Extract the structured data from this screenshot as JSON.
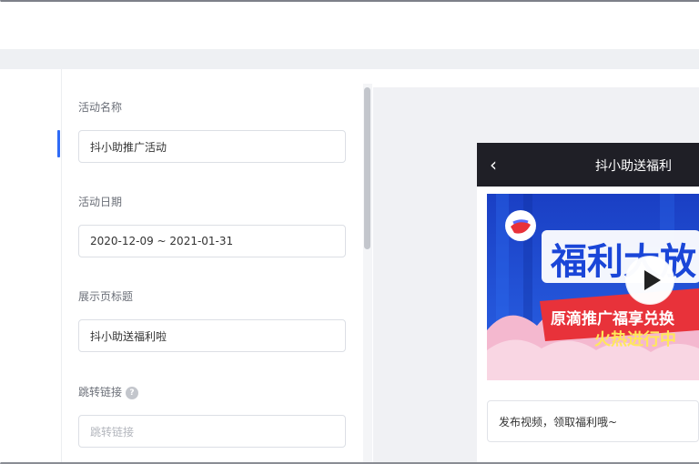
{
  "form": {
    "activity_name": {
      "label": "活动名称",
      "value": "抖小助推广活动"
    },
    "activity_date": {
      "label": "活动日期",
      "value": "2020-12-09 ~ 2021-01-31"
    },
    "page_title": {
      "label": "展示页标题",
      "value": "抖小助送福利啦"
    },
    "jump_link": {
      "label": "跳转链接",
      "placeholder": "跳转链接",
      "help_icon": "?"
    }
  },
  "preview": {
    "back_icon": "‹",
    "title": "抖小助送福利",
    "banner_headline": "福利大放",
    "banner_sub1": "原滴推广福享兑换",
    "banner_sub2": "火热进行中",
    "comment_text": "发布视频，领取福利哦~"
  },
  "colors": {
    "accent": "#2f6bf6",
    "phone_header": "#1f1f26",
    "banner_blue": "#1f4fd6",
    "banner_red": "#e8323a"
  }
}
